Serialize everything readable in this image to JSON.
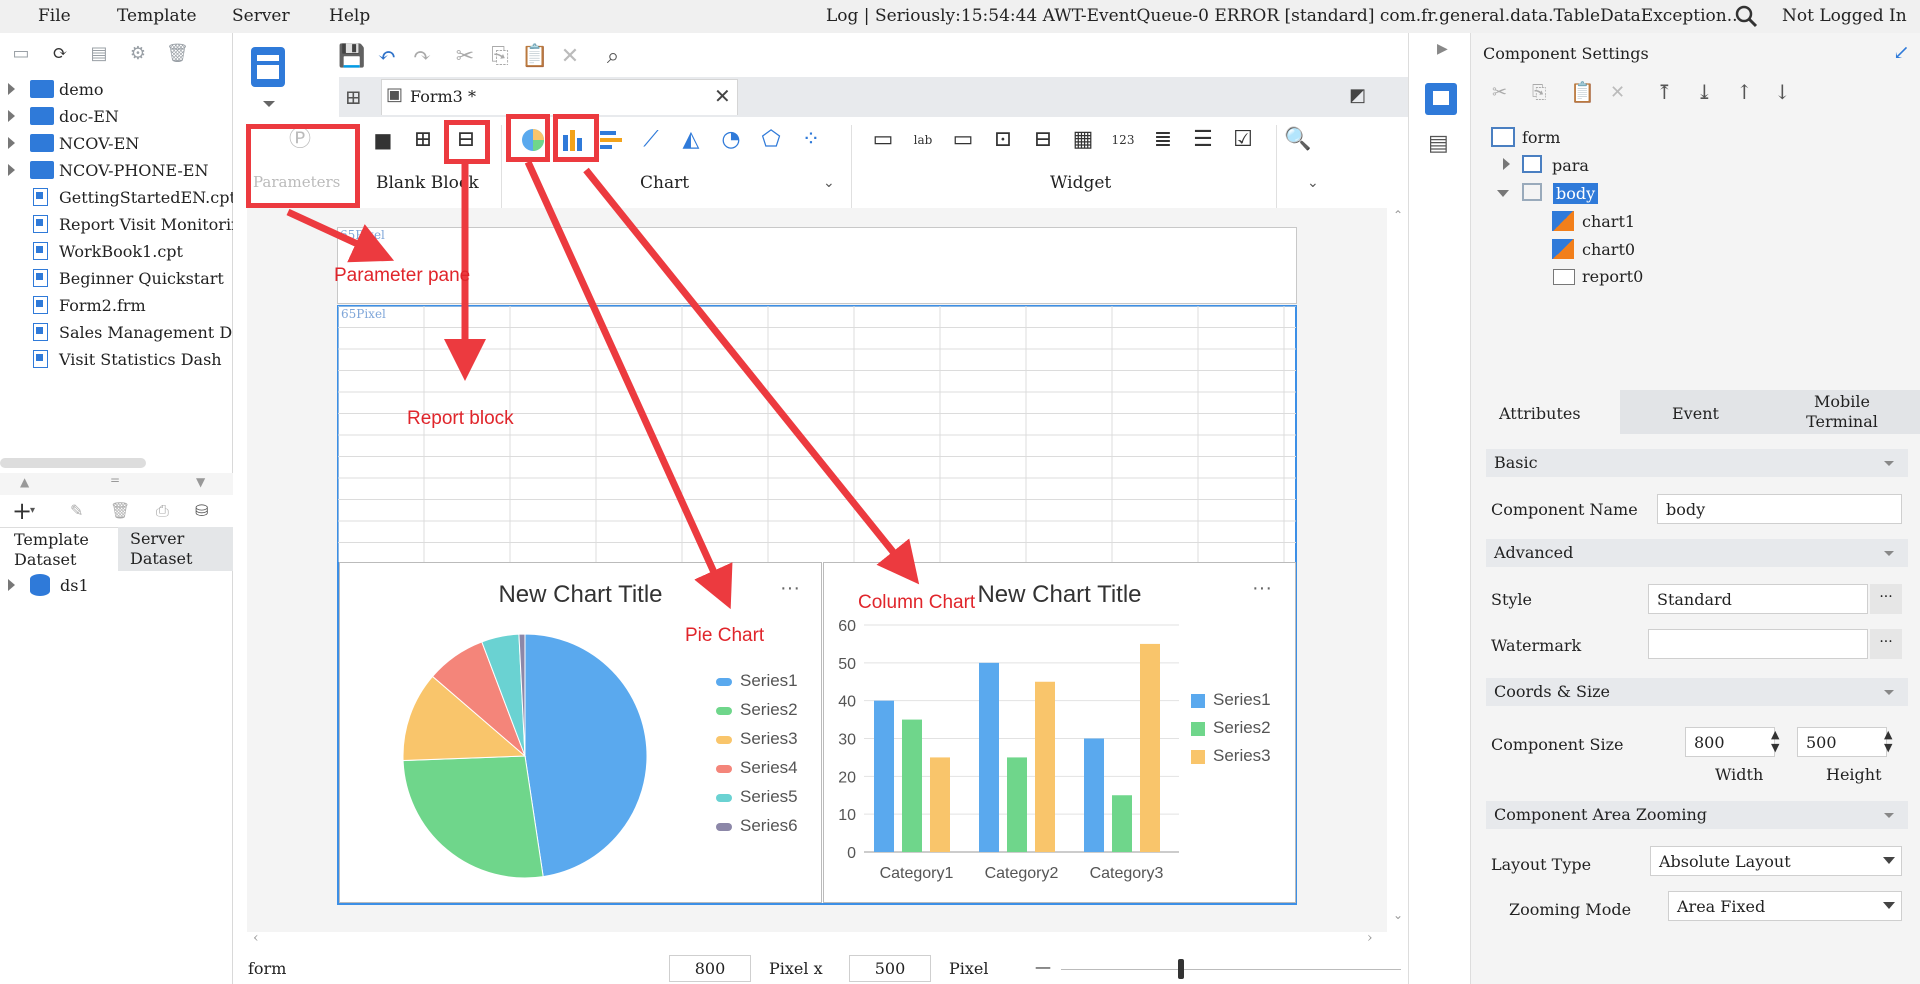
{
  "menu": {
    "file": "File",
    "template": "Template",
    "server": "Server",
    "help": "Help"
  },
  "log_text": "Log | Seriously:15:54:44 AWT-EventQueue-0 ERROR [standard] com.fr.general.data.TableDataException...",
  "login_status": "Not Logged In",
  "tree": {
    "items": [
      {
        "label": "demo",
        "type": "folder"
      },
      {
        "label": "doc-EN",
        "type": "folder"
      },
      {
        "label": "NCOV-EN",
        "type": "folder"
      },
      {
        "label": "NCOV-PHONE-EN",
        "type": "folder"
      },
      {
        "label": "GettingStartedEN.cpt",
        "type": "file"
      },
      {
        "label": "Report Visit Monitoring",
        "type": "file"
      },
      {
        "label": "WorkBook1.cpt",
        "type": "file"
      },
      {
        "label": "Beginner Quickstart",
        "type": "file"
      },
      {
        "label": "Form2.frm",
        "type": "file"
      },
      {
        "label": "Sales Management Dash",
        "type": "file"
      },
      {
        "label": "Visit Statistics Dash",
        "type": "file"
      }
    ]
  },
  "dataset": {
    "tab_template": "Template Dataset",
    "tab_server": "Server Dataset",
    "item": "ds1"
  },
  "editor": {
    "tab_label": "Form3 *"
  },
  "ribbon": {
    "parameters": "Parameters",
    "blank_block": "Blank Block",
    "chart": "Chart",
    "widget": "Widget"
  },
  "canvas": {
    "param_px": "65Pixel",
    "body_px": "65Pixel"
  },
  "pie_chart": {
    "title": "New Chart Title",
    "more": "···",
    "legend": [
      {
        "name": "Series1",
        "color": "#5aa9ee"
      },
      {
        "name": "Series2",
        "color": "#6fd68b"
      },
      {
        "name": "Series3",
        "color": "#f9c56b"
      },
      {
        "name": "Series4",
        "color": "#f4857a"
      },
      {
        "name": "Series5",
        "color": "#6ad2d2"
      },
      {
        "name": "Series6",
        "color": "#8c87a8"
      }
    ]
  },
  "column_chart": {
    "title": "New Chart Title",
    "more": "···",
    "ylim": [
      0,
      60
    ],
    "yticks": [
      "0",
      "10",
      "20",
      "30",
      "40",
      "50",
      "60"
    ],
    "legend": [
      {
        "name": "Series1",
        "color": "#5aa9ee"
      },
      {
        "name": "Series2",
        "color": "#6fd68b"
      },
      {
        "name": "Series3",
        "color": "#f9c56b"
      }
    ]
  },
  "chart_data": [
    {
      "type": "pie",
      "title": "New Chart Title",
      "categories": [
        "Series1",
        "Series2",
        "Series3",
        "Series4",
        "Series5",
        "Series6"
      ],
      "values": [
        48,
        27,
        12,
        8,
        5,
        0.8
      ]
    },
    {
      "type": "bar",
      "title": "New Chart Title",
      "categories": [
        "Category1",
        "Category2",
        "Category3"
      ],
      "series": [
        {
          "name": "Series1",
          "values": [
            40,
            50,
            30
          ]
        },
        {
          "name": "Series2",
          "values": [
            35,
            25,
            15
          ]
        },
        {
          "name": "Series3",
          "values": [
            25,
            45,
            55
          ]
        }
      ],
      "ylim": [
        0,
        60
      ]
    }
  ],
  "annotations": {
    "parameter_pane": "Parameter pane",
    "report_block": "Report block",
    "pie_chart": "Pie Chart",
    "column_chart": "Column Chart"
  },
  "status": {
    "left": "form",
    "width": "800",
    "height": "500",
    "unit": "Pixel",
    "x": "Pixel x"
  },
  "settings": {
    "title": "Component Settings",
    "tree": {
      "form": "form",
      "para": "para",
      "body": "body",
      "chart1": "chart1",
      "chart0": "chart0",
      "report0": "report0"
    },
    "tabs": {
      "attributes": "Attributes",
      "event": "Event",
      "mobile": "Mobile Terminal"
    },
    "basic": "Basic",
    "component_name_label": "Component Name",
    "component_name": "body",
    "advanced": "Advanced",
    "style_label": "Style",
    "style_value": "Standard",
    "watermark_label": "Watermark",
    "coords": "Coords & Size",
    "size_label": "Component Size",
    "width": "800",
    "height": "500",
    "width_label": "Width",
    "height_label": "Height",
    "zooming": "Component Area Zooming",
    "layout_label": "Layout Type",
    "layout_value": "Absolute Layout",
    "zoom_mode_label": "Zooming Mode",
    "zoom_mode_value": "Area Fixed"
  },
  "colors": {
    "accent": "#2f7ad9",
    "annotation": "#ec3a3f",
    "selection": "#3c8fe6"
  }
}
